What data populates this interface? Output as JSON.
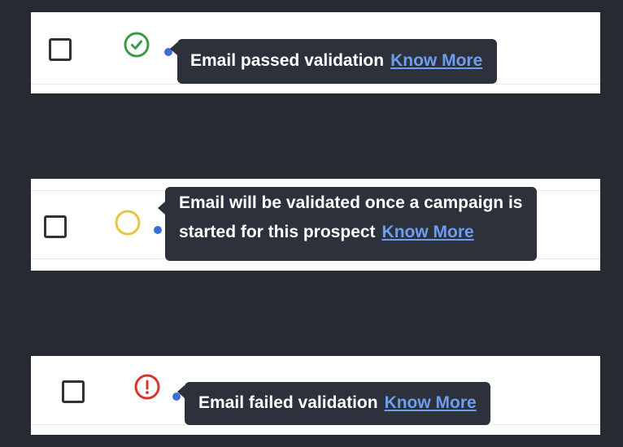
{
  "rows": [
    {
      "status": "passed",
      "icon": "check-circle-icon",
      "icon_color": "#3a9a4a",
      "tooltip_lines": [
        "Email passed validation"
      ],
      "link_label": "Know More"
    },
    {
      "status": "pending",
      "icon": "empty-circle-icon",
      "icon_color": "#e8c443",
      "tooltip_lines": [
        "Email will be validated once a campaign is",
        "started for this prospect"
      ],
      "link_label": "Know More"
    },
    {
      "status": "failed",
      "icon": "exclamation-circle-icon",
      "icon_color": "#d9362b",
      "tooltip_lines": [
        "Email failed validation"
      ],
      "link_label": "Know More"
    }
  ],
  "colors": {
    "background": "#262b32",
    "tooltip": "#2c313b",
    "link": "#6d9df0"
  }
}
